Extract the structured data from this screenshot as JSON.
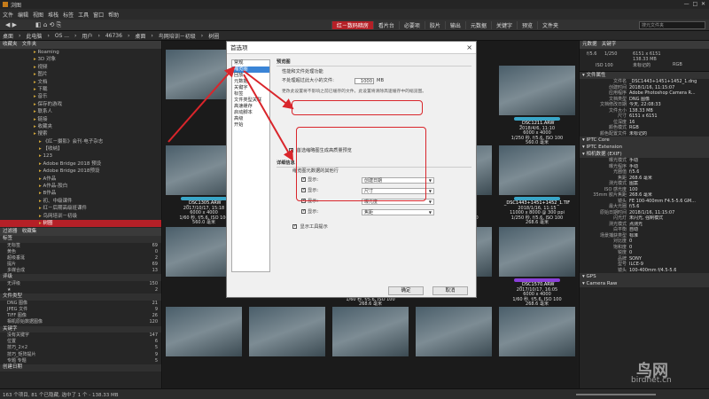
{
  "window": {
    "title": "浏图"
  },
  "menu": [
    "文件",
    "编辑",
    "视图",
    "堆栈",
    "标签",
    "工具",
    "窗口",
    "帮助"
  ],
  "workspace_tabs": [
    {
      "label": "红－数码暗房",
      "active": true
    },
    {
      "label": "看片台",
      "active": false
    },
    {
      "label": "必要项",
      "active": false
    },
    {
      "label": "胶片",
      "active": false
    },
    {
      "label": "输出",
      "active": false
    },
    {
      "label": "元数据",
      "active": false
    },
    {
      "label": "关键字",
      "active": false
    },
    {
      "label": "预览",
      "active": false
    },
    {
      "label": "文件夹",
      "active": false
    }
  ],
  "search_placeholder": "搜元文件夹",
  "breadcrumbs": [
    "桌面",
    "此电脑",
    "OS ...",
    "用户",
    "46736",
    "桌面",
    "鸟网培训－初级",
    "树圈"
  ],
  "left_panel": {
    "tabs": [
      "收藏夹",
      "文件夹"
    ],
    "tree": [
      "Roaming",
      "3D 对象",
      "视频",
      "图片",
      "文档",
      "下载",
      "音乐",
      "保存的游戏",
      "联系人",
      "链接",
      "收藏夹",
      "搜索",
      "《红－摄影》会刊·电子杂志",
      "【收纳】",
      "123",
      "Adobe Bridge 2018 预设",
      "Adobe Bridge 2018预设",
      "A作品",
      "A作品-胶白",
      "B作品",
      "初、中级课件",
      "红－后期高级班课件",
      "鸟网培训－初级",
      "树圈"
    ],
    "selected_index": 23,
    "filter_header": [
      "过滤器",
      "收藏集"
    ],
    "filter_sections": [
      {
        "title": "标签",
        "rows": [
          [
            "无标签",
            "69"
          ],
          [
            "黄色",
            "0"
          ],
          [
            "超级垂涎",
            "2"
          ],
          [
            "提片",
            "69"
          ],
          [
            "多媒合成",
            "13"
          ]
        ]
      },
      {
        "title": "评级",
        "rows": [
          [
            "无评级",
            "150"
          ],
          [
            "★",
            "2"
          ]
        ]
      },
      {
        "title": "文件类型",
        "rows": [
          [
            "DNG 图像",
            "21"
          ],
          [
            "JPEG 文件",
            "9"
          ],
          [
            "TIFF 图像",
            "26"
          ],
          [
            "相机原始数据图像",
            "120"
          ]
        ]
      },
      {
        "title": "关键字",
        "rows": [
          [
            "没有关键字",
            "147"
          ],
          [
            "位置",
            "6"
          ],
          [
            "技巧_2×2",
            "5"
          ],
          [
            "技巧_矩阵提片",
            "9"
          ],
          [
            "专题 专题",
            "5"
          ]
        ]
      },
      {
        "title": "创建日期",
        "rows": []
      }
    ]
  },
  "thumbnails": [
    {
      "name": "_DSC1305.ARW",
      "line2": "2017/10/17, 15:18",
      "line3": "6000 x 4000",
      "line4": "1/60 秒, f/5.6, ISO 100",
      "line5": "560.0 毫米"
    },
    {
      "name": "_DSC1443+1451+1452_2.TIF",
      "line2": "2018/1/16, 11:15",
      "line3": "11000 x 8000 @ 300 ppi",
      "line4": "1/250 秒, f/5.6, ISO 100",
      "line5": "268.6 毫米"
    },
    {
      "name": "_DSC1443+1451+1452.dng",
      "line2": "2018/1/16, 11:15",
      "line3": "6000 x 4000",
      "line4": "1/250 秒, f/5.6, ISO 100",
      "line5": "268.6 毫米"
    },
    {
      "name": "_DSC1569.ARW",
      "line2": "2017/10/17, 16:05",
      "line3": "6000 x 4000",
      "line4": "1/60 秒, f/5.6, ISO 100",
      "line5": "268.6 毫米"
    },
    {
      "name": "_DSC1569.tif",
      "line2": "2017/10/17, 16:05",
      "line3": "3992 x 3992 @ 300 ppi",
      "line4": "1/60 秒, f/5.6, ISO 100",
      "line5": "268.6 毫米"
    },
    {
      "name": "_DSC1570.ARW",
      "line2": "2017/10/17, 16:05",
      "line3": "6000 x 4000",
      "line4": "1/60 秒, f/5.6, ISO 100",
      "line5": "268.6 毫米"
    },
    {
      "name": "_DSC1211.ARW",
      "line2": "2018/4/6, 11:10",
      "line3": "6000 x 4000",
      "line4": "1/250 秒, f/5.6, ISO 100",
      "line5": "560.0 毫米"
    },
    {
      "name": "_DSC1443+1451+1452_1.TIF",
      "line2": "2018/1/16, 11:15",
      "line3": "11000 x 8000 @ 300 ppi",
      "line4": "1/250 秒, f/5.6, ISO 100",
      "line5": "268.6 毫米"
    }
  ],
  "right_panel": {
    "tabs": [
      "元数据",
      "关键字"
    ],
    "quick": [
      "f/5.6",
      "1/250",
      "ISO 100",
      "6151 x 6151",
      "138.33 MB",
      "未标记的",
      "RGB"
    ],
    "sections": [
      {
        "title": "文件属性",
        "rows": [
          [
            "文件名",
            "_DSC1443+1451+1452_1.dng"
          ],
          [
            "创建时间",
            "2018/1/16, 11:15:07"
          ],
          [
            "应用程序",
            "Adobe Photoshop Camera R..."
          ],
          [
            "文档类型",
            "DNG 图像"
          ],
          [
            "文档修改日期",
            "今天, 22:08:33"
          ],
          [
            "文件大小",
            "138.33 MB"
          ],
          [
            "尺寸",
            "6151 x 6151"
          ],
          [
            "位深度",
            "16"
          ],
          [
            "颜色模式",
            "RGB"
          ],
          [
            "颜色配置文件",
            "未标记的"
          ]
        ]
      },
      {
        "title": "IPTC Core",
        "rows": []
      },
      {
        "title": "IPTC Extension",
        "rows": []
      },
      {
        "title": "相机数据 (EXIF)",
        "rows": [
          [
            "曝光模式",
            "手动"
          ],
          [
            "曝光程序",
            "手动"
          ],
          [
            "光圈值",
            "f/5.6"
          ],
          [
            "焦距",
            "268.6 毫米"
          ],
          [
            "测光模式",
            "图案"
          ],
          [
            "ISO 感光度",
            "100"
          ],
          [
            "35mm 胶片焦距",
            "268.6 毫米"
          ],
          [
            "镜头",
            "FE 100-400mm F4.5-5.6 GM..."
          ],
          [
            "最大光圈",
            "f/5.6"
          ],
          [
            "原始日期时间",
            "2018/1/16, 11:15:07"
          ],
          [
            "闪光灯",
            "未闪光, 强制模式"
          ],
          [
            "测光模式",
            "点测光"
          ],
          [
            "白平衡",
            "自动"
          ],
          [
            "场景捕获类型",
            "标准"
          ],
          [
            "对比度",
            "0"
          ],
          [
            "饱和度",
            "0"
          ],
          [
            "锐度",
            "0"
          ],
          [
            "品牌",
            "SONY"
          ],
          [
            "型号",
            "ILCE-9"
          ],
          [
            "镜头",
            "100-400mm f/4.5-5.6"
          ]
        ]
      },
      {
        "title": "GPS",
        "rows": []
      },
      {
        "title": "Camera Raw",
        "rows": []
      }
    ]
  },
  "dialog": {
    "title": "首选项",
    "close": "×",
    "nav": [
      "常规",
      "缩览图",
      "回放",
      "元数据",
      "关键字",
      "标签",
      "文件类型关联",
      "高速缓存",
      "启动脚本",
      "高级",
      "开始"
    ],
    "nav_selected": 1,
    "section1_title": "预览图",
    "perf_label": "性能和文件处理功能",
    "size_label": "不处理超过此大小的文件:",
    "size_value": "1000",
    "size_unit": "MB",
    "note": "更改此设置将不影响之前已缓存的文件。此设置将清除高速缓存中的缩览图。",
    "hq_label": "首选缩略图生成高质量预览",
    "hq_checked": true,
    "section2_title": "详细信息",
    "show_meta_label": "缩览图元数据的其他行",
    "rows": [
      {
        "label": "显示:",
        "value": "创建日期",
        "checked": true
      },
      {
        "label": "显示:",
        "value": "尺寸",
        "checked": true
      },
      {
        "label": "显示:",
        "value": "曝光度",
        "checked": true
      },
      {
        "label": "显示:",
        "value": "焦距",
        "checked": true
      }
    ],
    "tooltip_label": "显示工具提示",
    "tooltip_checked": true,
    "ok": "确定",
    "cancel": "取消"
  },
  "status": "163 个项目, 81 个已隐藏, 选中了 1 个 - 138.33 MB",
  "watermark": {
    "text": "鸟网",
    "url": "birdnet.cn"
  },
  "colors": {
    "accent": "#b52027",
    "label_cyan": "#3aa6c8",
    "label_purple": "#8a3fd8",
    "label_red": "#d02a2a",
    "highlight": "#d9252b"
  }
}
